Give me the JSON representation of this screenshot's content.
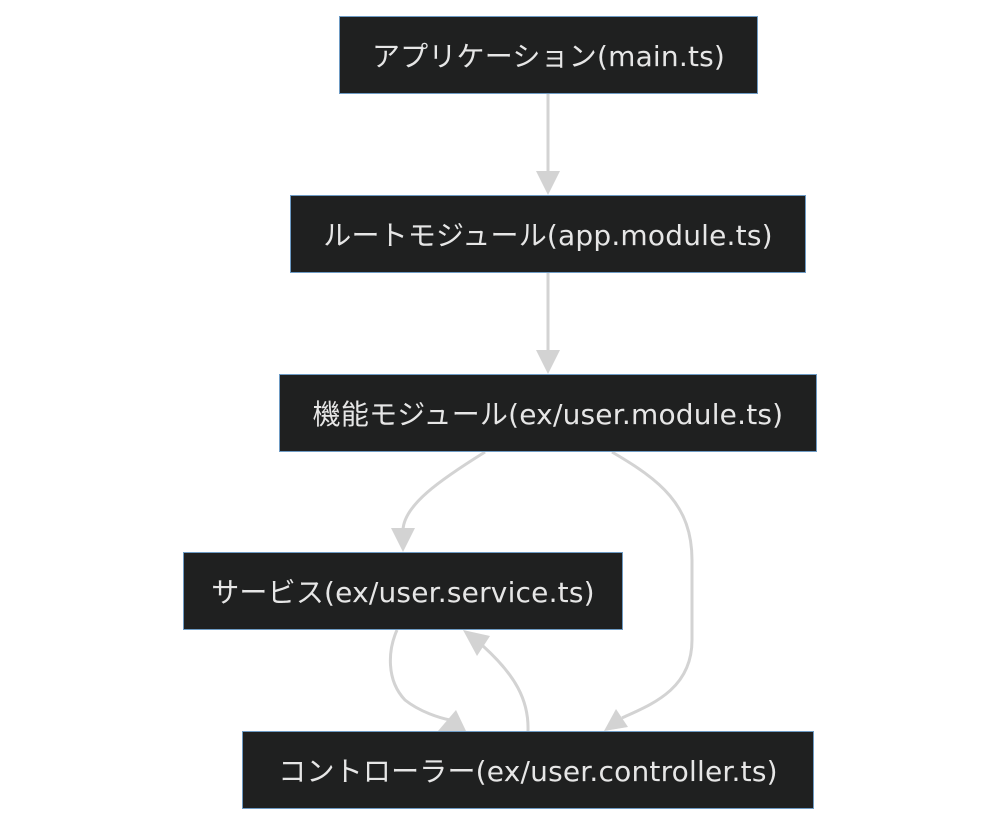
{
  "diagram": {
    "nodes": {
      "main": "アプリケーション(main.ts)",
      "root_module": "ルートモジュール(app.module.ts)",
      "feature_module": "機能モジュール(ex/user.module.ts)",
      "service": "サービス(ex/user.service.ts)",
      "controller": "コントローラー(ex/user.controller.ts)"
    },
    "edges": [
      {
        "from": "main",
        "to": "root_module"
      },
      {
        "from": "root_module",
        "to": "feature_module"
      },
      {
        "from": "feature_module",
        "to": "service"
      },
      {
        "from": "feature_module",
        "to": "controller"
      },
      {
        "from": "service",
        "to": "controller"
      },
      {
        "from": "controller",
        "to": "service"
      }
    ]
  },
  "colors": {
    "node_fill": "#1f2020",
    "node_border": "#6e9bc4",
    "node_text": "#e6e6e6",
    "edge": "#d3d3d3",
    "background": "#ffffff"
  }
}
